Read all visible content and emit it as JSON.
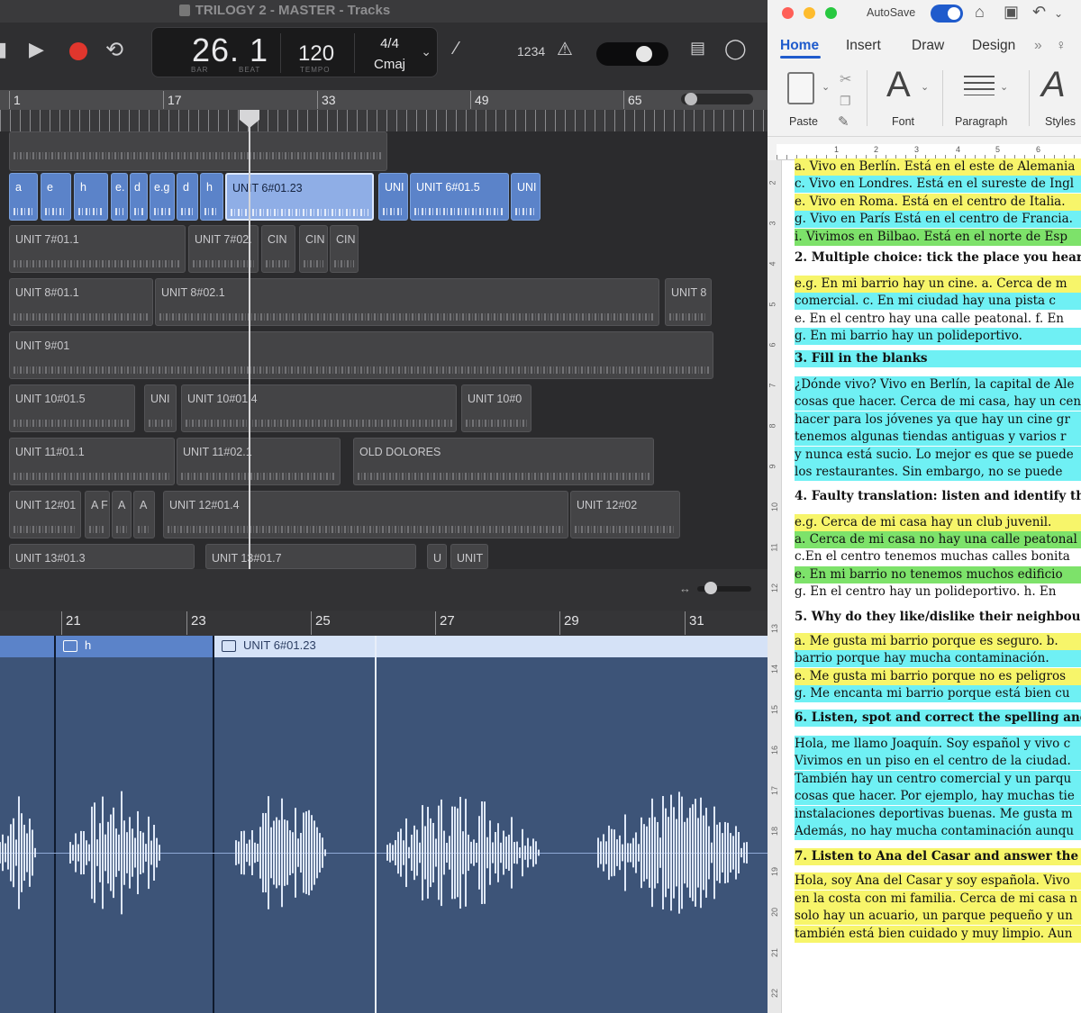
{
  "logic": {
    "window_title": "TRILOGY 2 - MASTER - Tracks",
    "lcd": {
      "position": "26. 1",
      "bar_label": "BAR",
      "beat_label": "BEAT",
      "tempo": "120",
      "tempo_label": "TEMPO",
      "time_signature": "4/4",
      "key": "Cmaj"
    },
    "count_in": "1234",
    "ruler_bars": [
      "1",
      "17",
      "33",
      "49",
      "65"
    ],
    "editor_ruler_bars": [
      "21",
      "23",
      "25",
      "27",
      "29",
      "31"
    ],
    "regions": [
      {
        "label": "a"
      },
      {
        "label": "e"
      },
      {
        "label": "h"
      },
      {
        "label": "e."
      },
      {
        "label": "d"
      },
      {
        "label": "e.g"
      },
      {
        "label": "d"
      },
      {
        "label": "h"
      },
      {
        "label": "UNIT 6#01.23"
      },
      {
        "label": "UNI"
      },
      {
        "label": "UNIT 6#01.5"
      },
      {
        "label": "UNI"
      },
      {
        "label": "UNIT 7#01.1"
      },
      {
        "label": "UNIT 7#02."
      },
      {
        "label": "CIN"
      },
      {
        "label": "CIN"
      },
      {
        "label": "CIN"
      },
      {
        "label": "UNIT 8#01.1"
      },
      {
        "label": "UNIT 8#02.1"
      },
      {
        "label": "UNIT 8"
      },
      {
        "label": "UNIT 9#01"
      },
      {
        "label": "UNIT 10#01.5"
      },
      {
        "label": "UNI"
      },
      {
        "label": "UNIT 10#01.4"
      },
      {
        "label": "UNIT 10#0"
      },
      {
        "label": "UNIT 11#01.1"
      },
      {
        "label": "UNIT 11#02.1"
      },
      {
        "label": "OLD DOLORES"
      },
      {
        "label": "UNIT 12#01"
      },
      {
        "label": "A F"
      },
      {
        "label": "A"
      },
      {
        "label": "A"
      },
      {
        "label": "UNIT 12#01.4"
      },
      {
        "label": "UNIT 12#02"
      },
      {
        "label": "UNIT 13#01.3"
      },
      {
        "label": "UNIT 13#01.7"
      },
      {
        "label": "U"
      },
      {
        "label": "UNIT"
      }
    ],
    "editor": {
      "region_left": "h",
      "region_main": "UNIT 6#01.23"
    }
  },
  "word": {
    "autosave_label": "AutoSave",
    "tabs": [
      "Home",
      "Insert",
      "Draw",
      "Design"
    ],
    "ribbon": {
      "paste": "Paste",
      "font": "Font",
      "paragraph": "Paragraph",
      "styles": "Styles"
    },
    "ruler_numbers": [
      "1",
      "2",
      "3",
      "4",
      "5",
      "6"
    ],
    "vertical_ruler_numbers": [
      "2",
      "3",
      "4",
      "5",
      "6",
      "7",
      "8",
      "9",
      "10",
      "11",
      "12",
      "13",
      "14",
      "15",
      "16",
      "17",
      "18",
      "19",
      "20",
      "21",
      "22"
    ],
    "lines": [
      {
        "text": "a. Vivo en Berlín. Está en el este de Alemania",
        "hl": "y",
        "bold": false
      },
      {
        "text": "c. Vivo en Londres. Está en el sureste de Ingl",
        "hl": "c",
        "bold": false
      },
      {
        "text": "e. Vivo en Roma. Está en el centro de Italia.",
        "hl": "y",
        "bold": false
      },
      {
        "text": "g. Vivo en París Está en el centro de Francia.",
        "hl": "c",
        "bold": false
      },
      {
        "text": "i. Vivimos en Bilbao. Está en el norte de Esp",
        "hl": "g",
        "bold": false
      },
      {
        "text": "2. Multiple choice: tick the place you hear",
        "hl": "none",
        "bold": true
      },
      {
        "text": "e.g. En mi barrio hay un cine.     a. Cerca de m",
        "hl": "y",
        "bold": false
      },
      {
        "text": "comercial.     c. En mi ciudad hay una pista c",
        "hl": "c",
        "bold": false
      },
      {
        "text": "e. En el centro hay una calle peatonal.   f. En",
        "hl": "none",
        "bold": false
      },
      {
        "text": "g. En mi barrio hay un polideportivo.",
        "hl": "c",
        "bold": false
      },
      {
        "text": "3. Fill in the blanks",
        "hl": "c",
        "bold": true
      },
      {
        "text": "¿Dónde vivo? Vivo en Berlín, la capital de Ale",
        "hl": "c",
        "bold": false
      },
      {
        "text": "cosas que hacer. Cerca de mi casa, hay un cen",
        "hl": "c",
        "bold": false
      },
      {
        "text": "hacer para los jóvenes ya que hay un cine gr",
        "hl": "c",
        "bold": false
      },
      {
        "text": "tenemos algunas tiendas antiguas y varios r",
        "hl": "c",
        "bold": false
      },
      {
        "text": "y nunca está sucio. Lo mejor es que se puede",
        "hl": "c",
        "bold": false
      },
      {
        "text": "los restaurantes. Sin embargo, no se puede",
        "hl": "c",
        "bold": false
      },
      {
        "text": "4. Faulty translation: listen and identify th",
        "hl": "none",
        "bold": true
      },
      {
        "text": "e.g. Cerca de mi casa hay un club juvenil.",
        "hl": "y",
        "bold": false
      },
      {
        "text": "a. Cerca de mi casa no hay una calle peatonal",
        "hl": "g",
        "bold": false
      },
      {
        "text": "c.En el centro tenemos muchas calles bonita",
        "hl": "none",
        "bold": false
      },
      {
        "text": "e. En mi barrio no tenemos muchos edificio",
        "hl": "g",
        "bold": false
      },
      {
        "text": "g. En el centro hay un polideportivo.     h. En",
        "hl": "none",
        "bold": false
      },
      {
        "text": "5. Why do they like/dislike their neighbou",
        "hl": "none",
        "bold": true
      },
      {
        "text": "a. Me gusta mi barrio porque es seguro.     b.",
        "hl": "y",
        "bold": false
      },
      {
        "text": "barrio porque hay mucha contaminación.",
        "hl": "c",
        "bold": false
      },
      {
        "text": "e. Me gusta mi barrio porque no es peligros",
        "hl": "y",
        "bold": false
      },
      {
        "text": "g. Me encanta mi barrio porque está bien cu",
        "hl": "c",
        "bold": false
      },
      {
        "text": "6. Listen, spot and correct the spelling and",
        "hl": "c",
        "bold": true
      },
      {
        "text": "Hola, me llamo Joaquín. Soy español y vivo c",
        "hl": "c",
        "bold": false
      },
      {
        "text": "Vivimos en un piso en el centro de la ciudad.",
        "hl": "c",
        "bold": false
      },
      {
        "text": "También hay un centro comercial y un parqu",
        "hl": "c",
        "bold": false
      },
      {
        "text": "cosas que hacer. Por ejemplo, hay muchas tie",
        "hl": "c",
        "bold": false
      },
      {
        "text": "instalaciones deportivas buenas. Me gusta m",
        "hl": "c",
        "bold": false
      },
      {
        "text": "Además, no hay mucha contaminación aunqu",
        "hl": "c",
        "bold": false
      },
      {
        "text": "7. Listen to Ana del Casar and answer the",
        "hl": "y",
        "bold": true
      },
      {
        "text": "Hola, soy Ana del Casar y soy española. Vivo",
        "hl": "y",
        "bold": false
      },
      {
        "text": "en la costa con mi familia. Cerca de mi casa n",
        "hl": "y",
        "bold": false
      },
      {
        "text": "solo hay un acuario, un parque pequeño y un",
        "hl": "y",
        "bold": false
      },
      {
        "text": "también está bien cuidado y muy limpio. Aun",
        "hl": "y",
        "bold": false
      }
    ]
  }
}
